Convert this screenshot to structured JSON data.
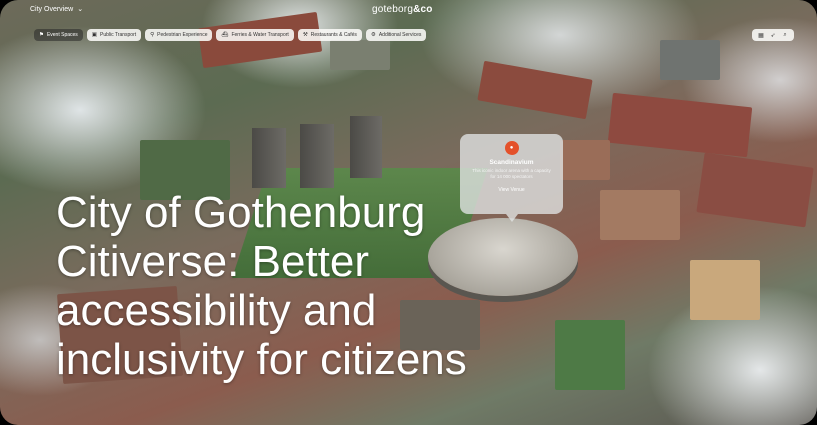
{
  "header": {
    "view_selector": "City Overview",
    "view_chevron": "⌄",
    "brand_prefix": "goteborg",
    "brand_suffix": "&co"
  },
  "categories": [
    {
      "icon": "flag-icon",
      "glyph": "⚑",
      "label": "Event Spaces",
      "active": true
    },
    {
      "icon": "bus-icon",
      "glyph": "▣",
      "label": "Public Transport",
      "active": false
    },
    {
      "icon": "pedestrian-icon",
      "glyph": "⚲",
      "label": "Pedestrian Experience",
      "active": false
    },
    {
      "icon": "ferry-icon",
      "glyph": "⛴",
      "label": "Ferries & Water Transport",
      "active": false
    },
    {
      "icon": "restaurant-icon",
      "glyph": "⚒",
      "label": "Restaurants & Cafés",
      "active": false
    },
    {
      "icon": "services-icon",
      "glyph": "⚙",
      "label": "Additional Services",
      "active": false
    }
  ],
  "tools": [
    {
      "icon": "map-layers-icon",
      "glyph": "▦"
    },
    {
      "icon": "compass-icon",
      "glyph": "➶"
    },
    {
      "icon": "search-icon",
      "glyph": "⌕"
    }
  ],
  "popup": {
    "title": "Scandinavium",
    "description": "This iconic indoor arena with a capacity for 14 000 spectators",
    "action": "View Venue",
    "pin_color": "#e4512a"
  },
  "headline": "City of Gothenburg Citiverse: Better accessibility and inclusivity for citizens"
}
